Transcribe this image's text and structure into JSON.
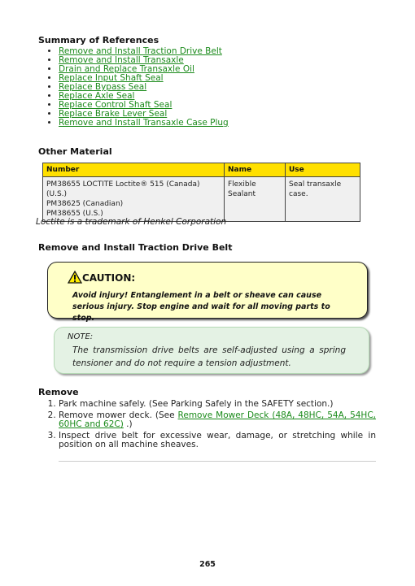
{
  "summary": {
    "heading": "Summary of References",
    "links": [
      "Remove and Install Traction Drive Belt",
      "Remove and Install Transaxle",
      "Drain and Replace Transaxle Oil",
      "Replace Input Shaft Seal",
      "Replace Bypass Seal",
      "Replace Axle Seal",
      "Replace Control Shaft Seal",
      "Replace Brake Lever Seal",
      "Remove and Install Transaxle Case Plug"
    ]
  },
  "other_material": {
    "heading": "Other Material",
    "columns": [
      "Number",
      "Name",
      "Use"
    ],
    "rows": [
      {
        "number_lines": [
          "PM38655 LOCTITE Loctite® 515 (Canada) (U.S.)",
          "PM38625 (Canadian)",
          "PM38655 (U.S.)"
        ],
        "name": "Flexible Sealant",
        "use": "Seal transaxle case."
      }
    ],
    "trademark": "Loctite is a trademark of Henkel Corporation"
  },
  "section": {
    "heading": "Remove and Install Traction Drive Belt",
    "caution": {
      "icon": "warning-triangle-icon",
      "title": "CAUTION:",
      "text": "Avoid injury! Entanglement in a belt or sheave can cause serious injury. Stop engine and wait for all moving parts to stop."
    },
    "note": {
      "label": "NOTE:",
      "text": "The transmission drive belts are self-adjusted using a spring tensioner and do not require a tension adjustment."
    }
  },
  "remove": {
    "heading": "Remove",
    "steps": [
      {
        "text": "Park machine safely. (See Parking Safely in the SAFETY section.)"
      },
      {
        "prefix": "Remove mower deck. (See ",
        "link": "Remove Mower Deck (48A, 48HC, 54A, 54HC, 60HC and 62C)",
        "suffix": " .)"
      },
      {
        "text": "Inspect drive belt for excessive wear, damage, or stretching while in position on all machine sheaves."
      }
    ]
  },
  "page_number": "265"
}
